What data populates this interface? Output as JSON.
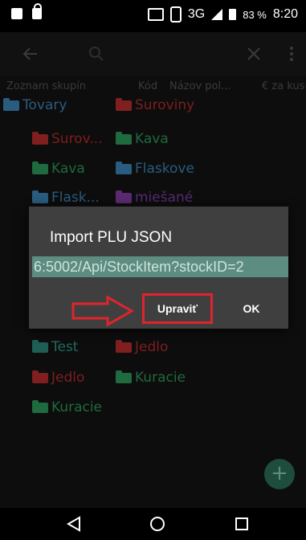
{
  "status_bar": {
    "left_icons": [
      "printer-icon",
      "lock-icon"
    ],
    "network": "3G",
    "network_sup": "3G",
    "battery": "83 %",
    "time": "8:20"
  },
  "toolbar": {
    "back_icon": "back-arrow-icon",
    "search_icon": "search-icon",
    "close_icon": "close-icon",
    "menu_icon": "more-vertical-icon"
  },
  "columns": [
    "Zoznam skupín",
    "Kód",
    "Názov pol...",
    "€ za kus"
  ],
  "tree": [
    {
      "label": "Tovary",
      "folder": "blue"
    },
    {
      "label": "Suroviny",
      "folder": "red"
    },
    {
      "label": "Surov...",
      "folder": "red"
    },
    {
      "label": "Kava",
      "folder": "green"
    },
    {
      "label": "Kava",
      "folder": "green"
    },
    {
      "label": "Flaskove",
      "folder": "blue"
    },
    {
      "label": "Flask...",
      "folder": "blue"
    },
    {
      "label": "miešané",
      "folder": "purple"
    },
    {
      "label": "Test",
      "folder": "teal"
    },
    {
      "label": "Jedlo",
      "folder": "red"
    },
    {
      "label": "Jedlo",
      "folder": "red"
    },
    {
      "label": "Kuracie",
      "folder": "green"
    },
    {
      "label": "Kuracie",
      "folder": "green"
    }
  ],
  "dialog": {
    "title": "Import PLU JSON",
    "url_value": "6:5002/Api/StockItem?stockID=2",
    "edit_button": "Upraviť",
    "ok_button": "OK"
  },
  "fab": {
    "label": "+"
  },
  "nav": {
    "back": "back-icon",
    "home": "home-icon",
    "recents": "recents-icon"
  },
  "colors": {
    "highlight": "#e1242b",
    "input_bg": "#5d8c80"
  }
}
